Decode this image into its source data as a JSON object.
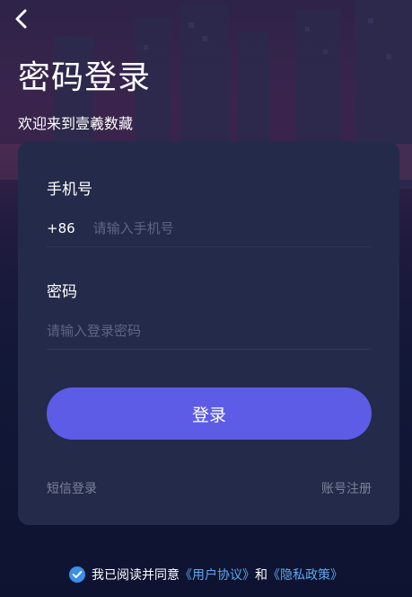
{
  "header": {
    "back_icon": "chevron-left-icon",
    "title": "密码登录",
    "subtitle": "欢迎来到壹羲数藏"
  },
  "form": {
    "phone": {
      "label": "手机号",
      "prefix": "+86",
      "placeholder": "请输入手机号",
      "value": ""
    },
    "password": {
      "label": "密码",
      "placeholder": "请输入登录密码",
      "value": ""
    },
    "login_button": "登录",
    "sms_login_link": "短信登录",
    "register_link": "账号注册"
  },
  "agreement": {
    "checked": true,
    "check_icon": "check-circle-icon",
    "prefix_text": "我已阅读并同意",
    "user_agreement": "《用户协议》",
    "conjunction": "和",
    "privacy_policy": "《隐私政策》"
  },
  "colors": {
    "accent": "#5d5ce6",
    "card_bg": "#232a4a",
    "link_blue": "#5ea8f0",
    "muted_text": "#7d8299",
    "placeholder": "#5f6685"
  }
}
